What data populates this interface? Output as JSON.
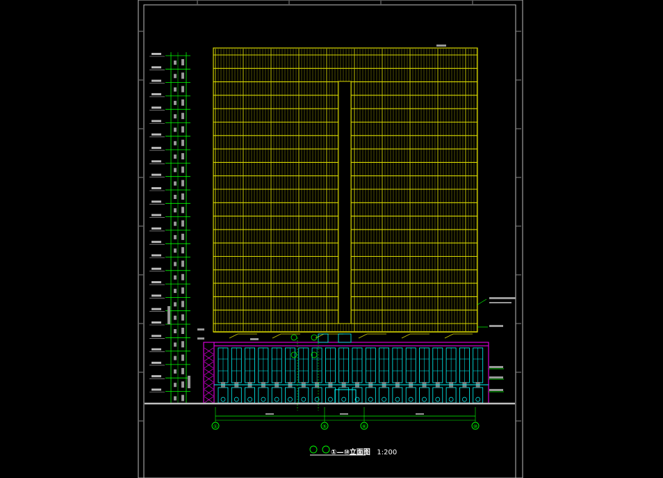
{
  "drawing": {
    "title": "①—⑩立面图",
    "scale": "1:200",
    "grid_labels": [
      "①",
      "⑤",
      "⑥",
      "⑩"
    ],
    "colors": {
      "background": "#000000",
      "frame": "#bfbfbf",
      "tower": "#d9d900",
      "podium_frame": "#ff00ff",
      "glazing": "#00ffff",
      "dimension": "#00ff00",
      "ground": "#c0c0c0",
      "text": "#ffffff"
    }
  }
}
